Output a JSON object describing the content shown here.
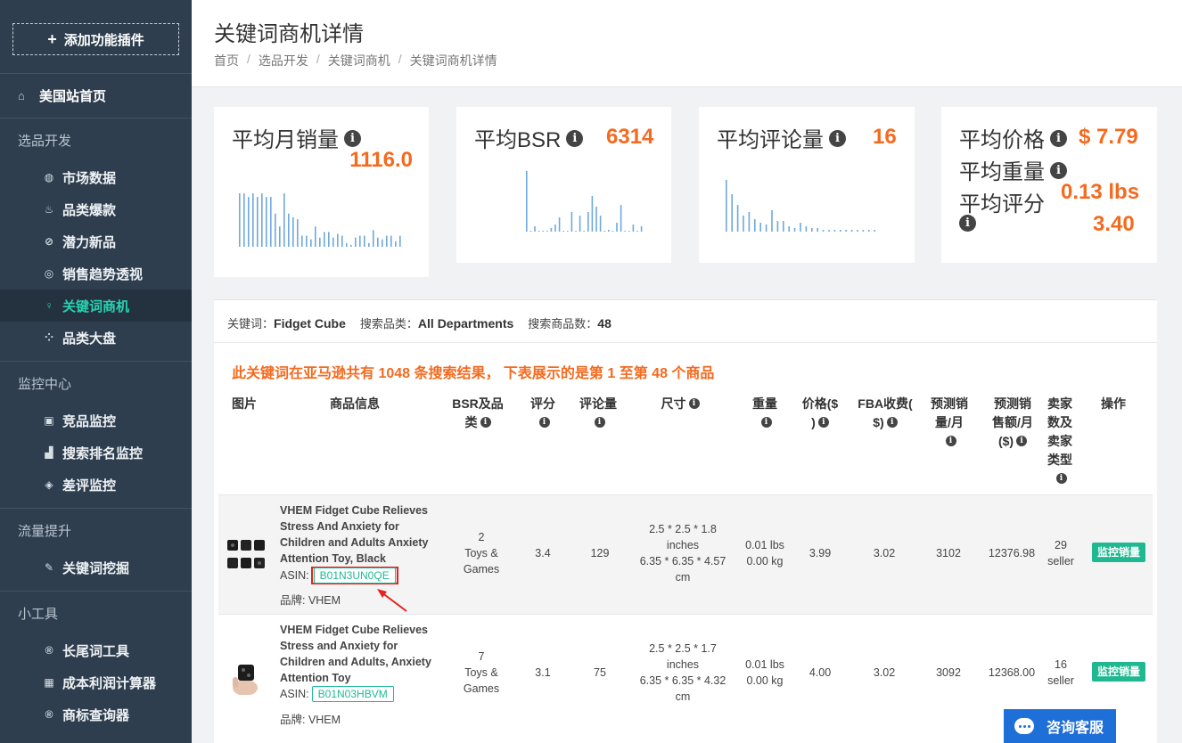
{
  "sidebar": {
    "add_plugin": "添加功能插件",
    "home": "美国站首页",
    "groups": [
      {
        "title": "选品开发",
        "items": [
          {
            "label": "市场数据",
            "icon": "globe-icon"
          },
          {
            "label": "品类爆款",
            "icon": "fire-icon"
          },
          {
            "label": "潜力新品",
            "icon": "link-icon"
          },
          {
            "label": "销售趋势透视",
            "icon": "target-icon"
          },
          {
            "label": "关键词商机",
            "icon": "lightbulb-icon",
            "active": true
          },
          {
            "label": "品类大盘",
            "icon": "grid-icon"
          }
        ]
      },
      {
        "title": "监控中心",
        "items": [
          {
            "label": "竞品监控",
            "icon": "image-icon"
          },
          {
            "label": "搜索排名监控",
            "icon": "bar-chart-icon"
          },
          {
            "label": "差评监控",
            "icon": "layers-icon"
          }
        ]
      },
      {
        "title": "流量提升",
        "items": [
          {
            "label": "关键词挖掘",
            "icon": "pencil-icon"
          }
        ]
      },
      {
        "title": "小工具",
        "items": [
          {
            "label": "长尾词工具",
            "icon": "registered-icon"
          },
          {
            "label": "成本利润计算器",
            "icon": "calculator-icon"
          },
          {
            "label": "商标查询器",
            "icon": "registered-icon"
          }
        ]
      }
    ]
  },
  "header": {
    "title": "关键词商机详情",
    "breadcrumb": [
      "首页",
      "选品开发",
      "关键词商机",
      "关键词商机详情"
    ]
  },
  "stats": {
    "avg_monthly_sales": {
      "label": "平均月销量",
      "value": "1116.0"
    },
    "avg_bsr": {
      "label": "平均BSR",
      "value": "6314"
    },
    "avg_reviews": {
      "label": "平均评论量",
      "value": "16"
    },
    "avg_price": {
      "label": "平均价格",
      "value": "$ 7.79"
    },
    "avg_weight": {
      "label": "平均重量",
      "value": "0.13 lbs"
    },
    "avg_rating": {
      "label": "平均评分",
      "value": "3.40"
    }
  },
  "sparklines": {
    "color": "#6fa8dc",
    "sales": [
      58,
      58,
      54,
      58,
      54,
      58,
      54,
      54,
      36,
      22,
      58,
      36,
      32,
      30,
      12,
      12,
      8,
      22,
      10,
      16,
      16,
      10,
      14,
      12,
      4,
      2,
      10,
      12,
      12,
      4,
      18,
      10,
      8,
      12,
      12,
      6,
      12
    ],
    "bsr": [
      68,
      0,
      6,
      0,
      0,
      0,
      4,
      8,
      16,
      0,
      0,
      22,
      0,
      18,
      0,
      22,
      40,
      28,
      18,
      0,
      2,
      0,
      10,
      30,
      0,
      0,
      8,
      0,
      6
    ],
    "reviews": [
      58,
      42,
      30,
      18,
      22,
      14,
      10,
      8,
      24,
      12,
      12,
      6,
      4,
      10,
      6,
      4,
      4,
      2,
      2,
      2,
      2,
      2,
      2,
      2,
      2,
      2,
      2
    ]
  },
  "keyword_info": {
    "keyword_label": "关键词：",
    "keyword": "Fidget Cube",
    "category_label": "搜索品类：",
    "category": "All Departments",
    "count_label": "搜索商品数：",
    "count": "48"
  },
  "result_message": "此关键词在亚马逊共有 1048 条搜索结果， 下表展示的是第 1 至第 48 个商品",
  "table": {
    "headers": {
      "image": "图片",
      "info": "商品信息",
      "bsr": "BSR及品类",
      "rating": "评分",
      "reviews": "评论量",
      "size": "尺寸",
      "weight": "重量",
      "price": "价格($)",
      "fba": "FBA收费($)",
      "pred_sales": "预测销量/月",
      "pred_revenue": "预测销售额/月($)",
      "sellers": "卖家数及卖家类型",
      "action": "操作"
    },
    "rows": [
      {
        "name": [
          "VHEM Fidget Cube Relieves",
          "Stress And Anxiety for",
          "Children and Adults Anxiety",
          "Attention Toy, Black"
        ],
        "asin_label": "ASIN:",
        "asin": "B01N3UN0QE",
        "brand": "品牌: VHEM",
        "bsr_rank": "2",
        "bsr_cat": [
          "Toys &",
          "Games"
        ],
        "rating": "3.4",
        "reviews": "129",
        "size": [
          "2.5 * 2.5 * 1.8",
          "inches",
          "6.35 * 6.35 * 4.57",
          "cm"
        ],
        "weight": [
          "0.01 lbs",
          "0.00 kg"
        ],
        "price": "3.99",
        "fba": "3.02",
        "pred_sales": "3102",
        "pred_revenue": "12376.98",
        "sellers": [
          "29",
          "seller"
        ],
        "action": "监控销量"
      },
      {
        "name": [
          "VHEM Fidget Cube Relieves",
          "Stress and Anxiety for",
          "Children and Adults, Anxiety",
          "Attention Toy"
        ],
        "asin_label": "ASIN:",
        "asin": "B01N03HBVM",
        "brand": "品牌: VHEM",
        "bsr_rank": "7",
        "bsr_cat": [
          "Toys &",
          "Games"
        ],
        "rating": "3.1",
        "reviews": "75",
        "size": [
          "2.5 * 2.5 * 1.7",
          "inches",
          "6.35 * 6.35 * 4.32",
          "cm"
        ],
        "weight": [
          "0.01 lbs",
          "0.00 kg"
        ],
        "price": "4.00",
        "fba": "3.02",
        "pred_sales": "3092",
        "pred_revenue": "12368.00",
        "sellers": [
          "16",
          "seller"
        ],
        "action": "监控销量"
      }
    ]
  },
  "chat": {
    "label": "咨询客服"
  }
}
